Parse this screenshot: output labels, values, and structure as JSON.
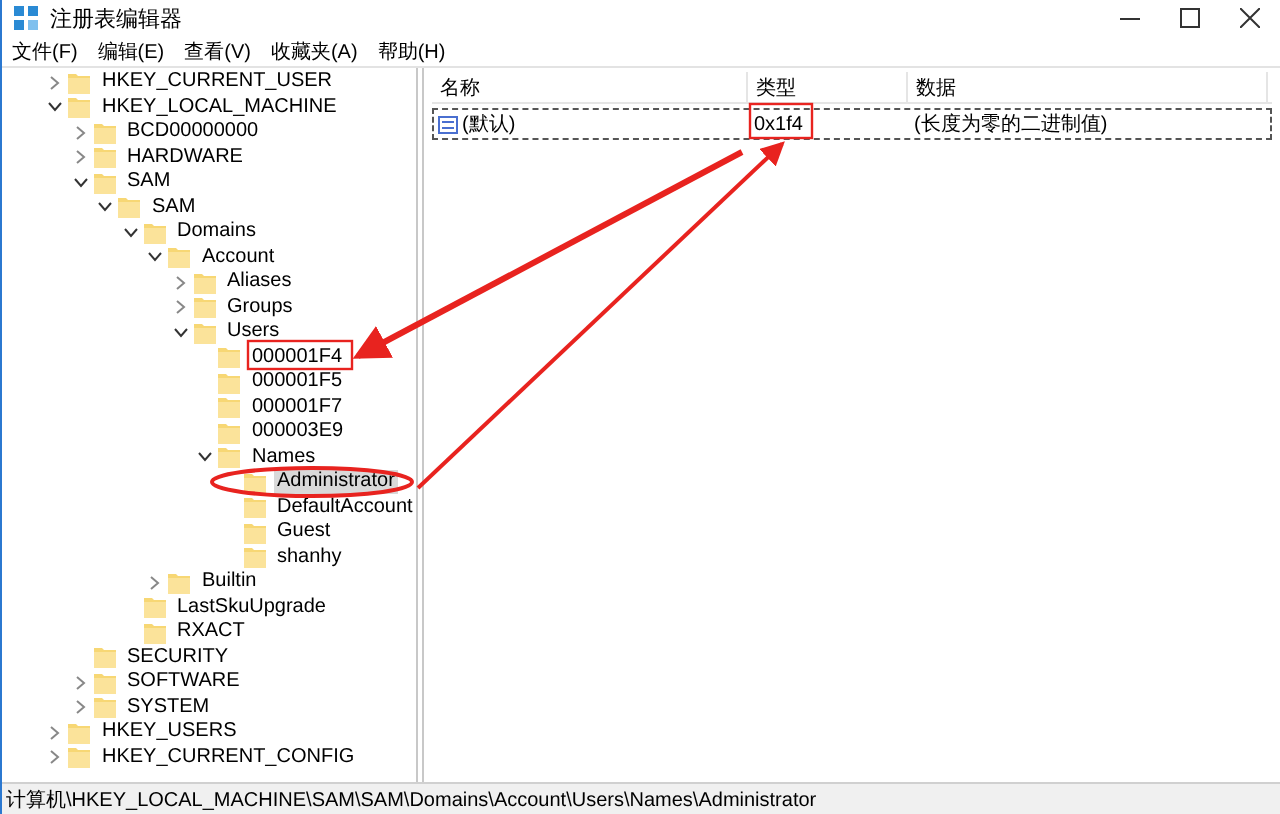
{
  "window": {
    "title": "注册表编辑器"
  },
  "menu": [
    "文件(F)",
    "编辑(E)",
    "查看(V)",
    "收藏夹(A)",
    "帮助(H)"
  ],
  "tree": [
    {
      "label": "HKEY_CURRENT_USER",
      "expanded": false,
      "selected": false
    },
    {
      "label": "HKEY_LOCAL_MACHINE",
      "expanded": true,
      "selected": false,
      "children": [
        {
          "label": "BCD00000000",
          "expanded": false,
          "selected": false
        },
        {
          "label": "HARDWARE",
          "expanded": false,
          "selected": false
        },
        {
          "label": "SAM",
          "expanded": true,
          "selected": false,
          "children": [
            {
              "label": "SAM",
              "expanded": true,
              "selected": false,
              "children": [
                {
                  "label": "Domains",
                  "expanded": true,
                  "selected": false,
                  "children": [
                    {
                      "label": "Account",
                      "expanded": true,
                      "selected": false,
                      "children": [
                        {
                          "label": "Aliases",
                          "expanded": false,
                          "selected": false
                        },
                        {
                          "label": "Groups",
                          "expanded": false,
                          "selected": false
                        },
                        {
                          "label": "Users",
                          "expanded": true,
                          "selected": false,
                          "children": [
                            {
                              "label": "000001F4",
                              "selected": false
                            },
                            {
                              "label": "000001F5",
                              "selected": false
                            },
                            {
                              "label": "000001F7",
                              "selected": false
                            },
                            {
                              "label": "000003E9",
                              "selected": false
                            },
                            {
                              "label": "Names",
                              "expanded": true,
                              "selected": false,
                              "children": [
                                {
                                  "label": "Administrator",
                                  "selected": true
                                },
                                {
                                  "label": "DefaultAccount",
                                  "selected": false
                                },
                                {
                                  "label": "Guest",
                                  "selected": false
                                },
                                {
                                  "label": "shanhy",
                                  "selected": false
                                }
                              ]
                            }
                          ]
                        }
                      ]
                    },
                    {
                      "label": "Builtin",
                      "expanded": false,
                      "selected": false
                    }
                  ]
                },
                {
                  "label": "LastSkuUpgrade",
                  "selected": false
                },
                {
                  "label": "RXACT",
                  "selected": false
                }
              ]
            }
          ]
        },
        {
          "label": "SECURITY",
          "selected": false
        },
        {
          "label": "SOFTWARE",
          "expanded": false,
          "selected": false
        },
        {
          "label": "SYSTEM",
          "expanded": false,
          "selected": false
        }
      ]
    },
    {
      "label": "HKEY_USERS",
      "expanded": false,
      "selected": false
    },
    {
      "label": "HKEY_CURRENT_CONFIG",
      "expanded": false,
      "selected": false
    }
  ],
  "values": {
    "columns": [
      "名称",
      "类型",
      "数据"
    ],
    "rows": [
      {
        "name": "(默认)",
        "type": "0x1f4",
        "data": "(长度为零的二进制值)",
        "selected": true
      }
    ]
  },
  "status_bar": "计算机\\HKEY_LOCAL_MACHINE\\SAM\\SAM\\Domains\\Account\\Users\\Names\\Administrator"
}
